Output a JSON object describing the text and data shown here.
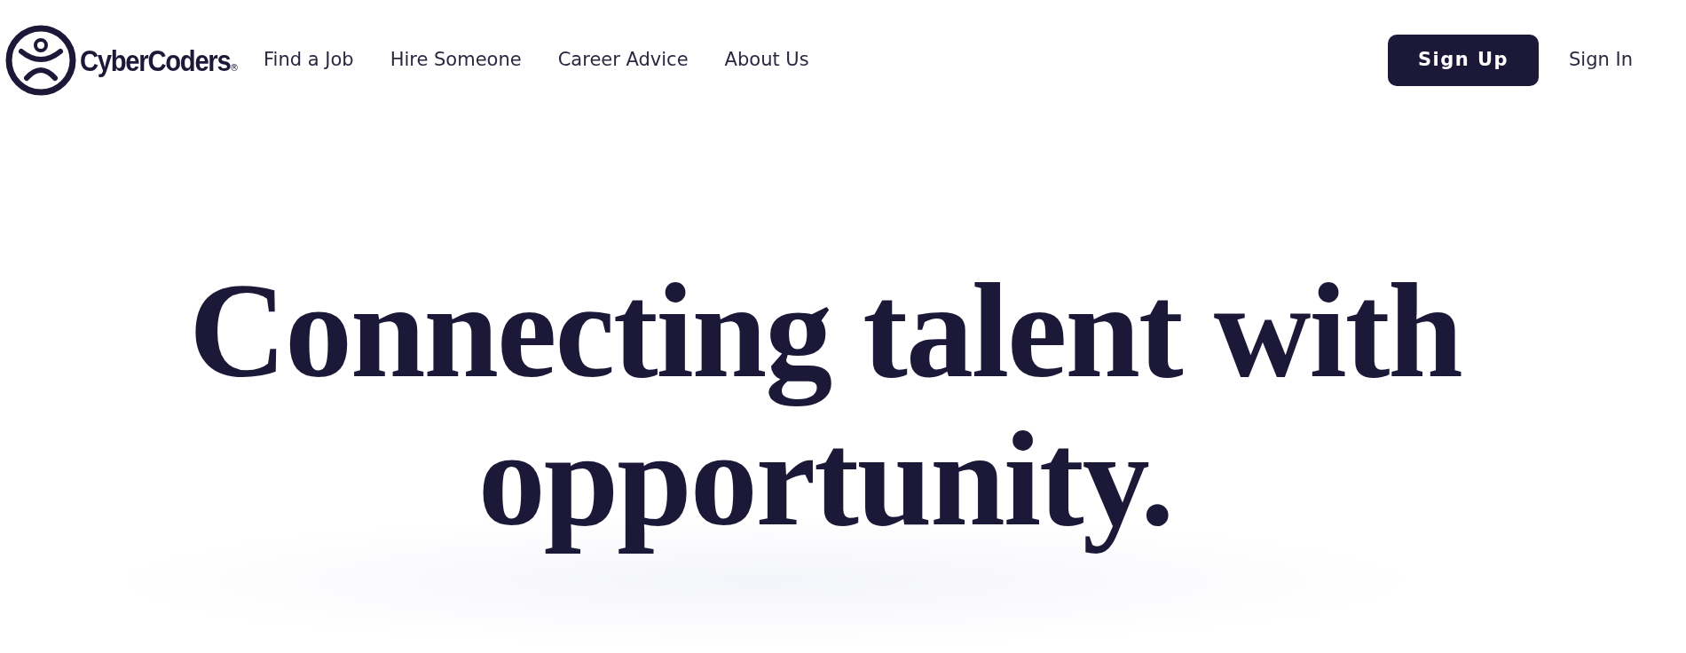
{
  "header": {
    "logo": {
      "text": "CyberCoders",
      "mark": "®"
    },
    "nav": [
      {
        "label": "Find a Job"
      },
      {
        "label": "Hire Someone"
      },
      {
        "label": "Career Advice"
      },
      {
        "label": "About Us"
      }
    ],
    "actions": [
      {
        "kind": "primary",
        "label": "Sign Up"
      },
      {
        "kind": "link",
        "label": "Sign In"
      }
    ]
  },
  "hero": {
    "headline_lines": [
      "Connecting talent with",
      "opportunity."
    ]
  }
}
